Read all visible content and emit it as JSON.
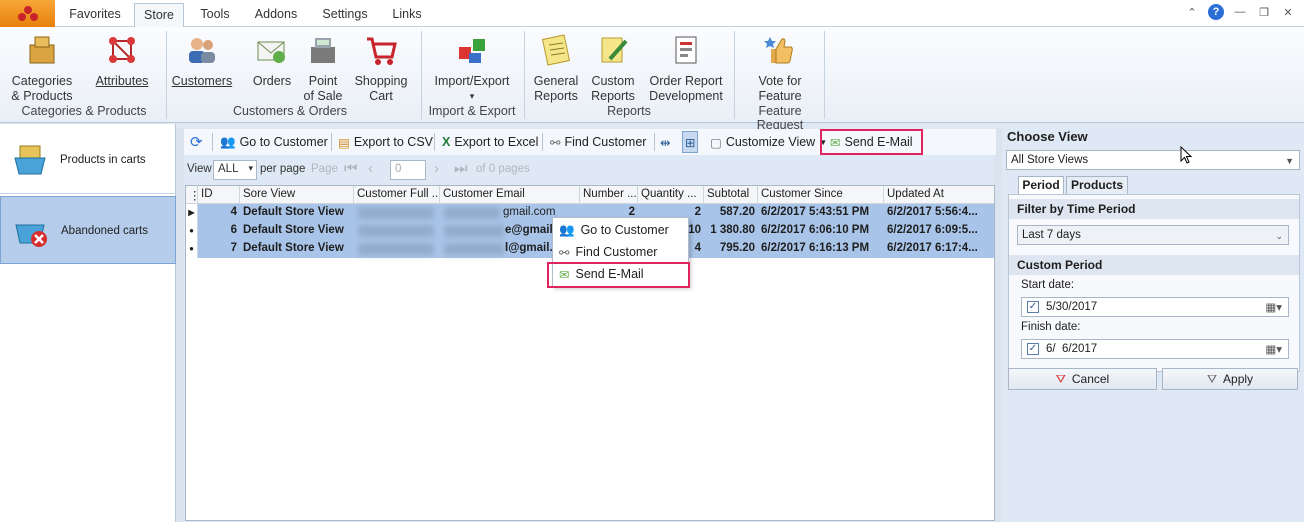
{
  "menu": {
    "tabs": [
      "Favorites",
      "Store",
      "Tools",
      "Addons",
      "Settings",
      "Links"
    ],
    "active": "Store"
  },
  "ribbon": {
    "buttons": [
      {
        "line1": "Categories",
        "line2": "& Products",
        "icon": "boxes-icon"
      },
      {
        "line1": "Attributes",
        "line2": "",
        "icon": "molecule-icon"
      },
      {
        "line1": "Customers",
        "line2": "",
        "icon": "people-icon"
      },
      {
        "line1": "Orders",
        "line2": "",
        "icon": "envelope-icon"
      },
      {
        "line1": "Point",
        "line2": "of Sale",
        "icon": "cash-register-icon"
      },
      {
        "line1": "Shopping",
        "line2": "Cart",
        "icon": "cart-icon"
      },
      {
        "line1": "Import/Export",
        "line2": "▾",
        "icon": "import-export-icon"
      },
      {
        "line1": "General",
        "line2": "Reports",
        "icon": "report-icon"
      },
      {
        "line1": "Custom",
        "line2": "Reports",
        "icon": "report-pen-icon"
      },
      {
        "line1": "Order Report",
        "line2": "Development",
        "icon": "report-dev-icon"
      },
      {
        "line1": "Vote for",
        "line2": "Feature",
        "icon": "thumbs-up-icon"
      }
    ],
    "groups": [
      "Categories & Products",
      "Customers & Orders",
      "Import & Export",
      "Reports",
      "Feature Request"
    ]
  },
  "leftnav": {
    "items": [
      {
        "label": "Products in carts",
        "icon": "basket-icon"
      },
      {
        "label": "Abandoned carts",
        "icon": "basket-x-icon"
      }
    ]
  },
  "toolbar": {
    "go_to_customer": "Go to Customer",
    "export_csv": "Export to CSV",
    "export_excel": "Export to Excel",
    "find_customer": "Find Customer",
    "customize_view": "Customize View",
    "send_email": "Send E-Mail"
  },
  "pager": {
    "view_label": "View",
    "view_value": "ALL",
    "per_page": "per page",
    "page_label": "Page",
    "page_value": "0",
    "of_pages": "of 0 pages"
  },
  "grid": {
    "columns": [
      "ID",
      "Sore View",
      "Customer Full ...",
      "Customer Email",
      "Number ...",
      "Quantity ...",
      "Subtotal",
      "Customer Since",
      "Updated At"
    ],
    "rows": [
      {
        "id": "4",
        "store": "Default Store View",
        "email": "gmail.com",
        "number": "2",
        "qty": "2",
        "subtotal": "587.20",
        "since": "6/2/2017 5:43:51 PM",
        "updated": "6/2/2017 5:56:4..."
      },
      {
        "id": "6",
        "store": "Default Store View",
        "email": "e@gmail.c",
        "number": "",
        "qty": "10",
        "subtotal": "1 380.80",
        "since": "6/2/2017 6:06:10 PM",
        "updated": "6/2/2017 6:09:5..."
      },
      {
        "id": "7",
        "store": "Default Store View",
        "email": "l@gmail.c",
        "number": "",
        "qty": "4",
        "subtotal": "795.20",
        "since": "6/2/2017 6:16:13 PM",
        "updated": "6/2/2017 6:17:4..."
      }
    ]
  },
  "context_menu": {
    "items": [
      "Go to Customer",
      "Find Customer",
      "Send E-Mail"
    ]
  },
  "right_panel": {
    "title": "Choose View",
    "store_view": "All Store Views",
    "tabs": [
      "Period",
      "Products"
    ],
    "filter_header": "Filter by Time Period",
    "period_value": "Last 7 days",
    "custom_header": "Custom Period",
    "start_label": "Start date:",
    "start_value": "5/30/2017",
    "finish_label": "Finish date:",
    "finish_value": "6/  6/2017",
    "cancel": "Cancel",
    "apply": "Apply"
  }
}
